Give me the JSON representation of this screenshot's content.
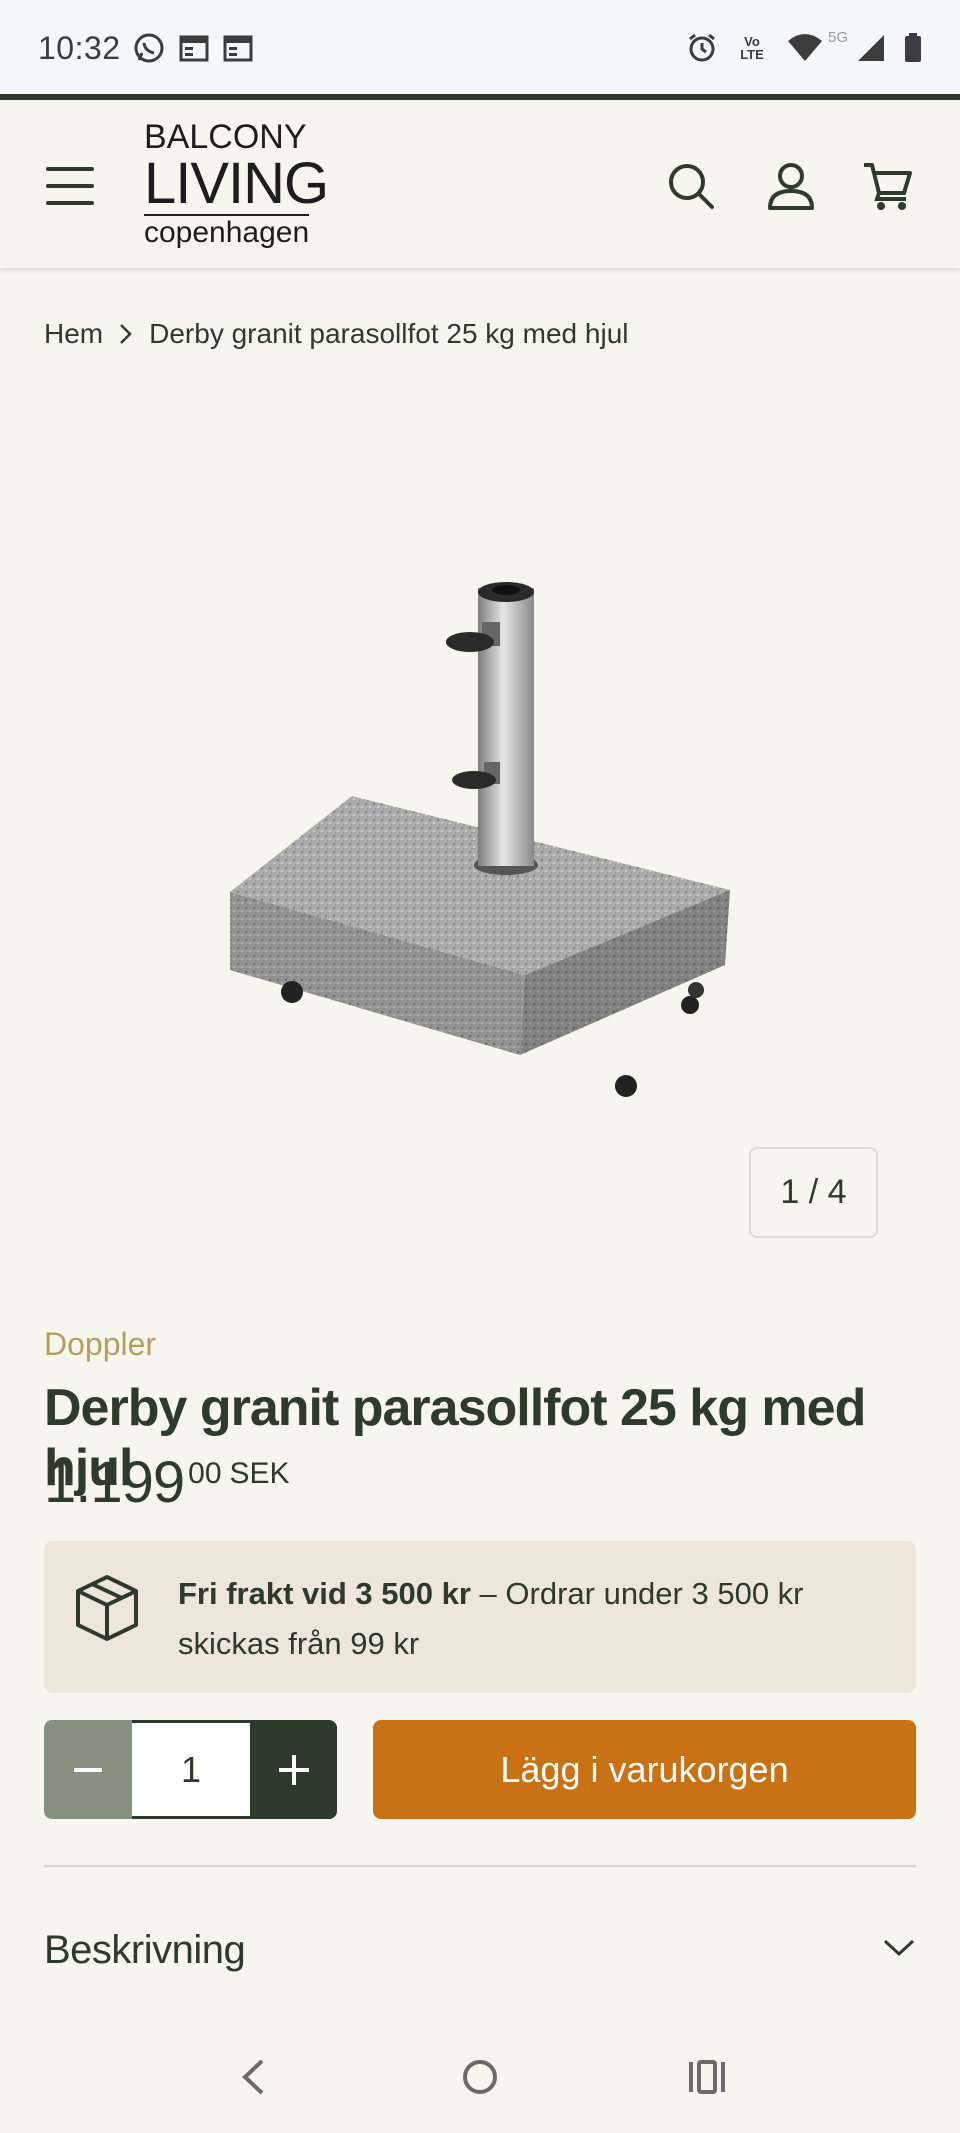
{
  "status_bar": {
    "time": "10:32",
    "network": "5G",
    "volte": "Vo LTE",
    "icons_left": [
      "whatsapp-icon",
      "calendar-icon",
      "calendar-icon"
    ],
    "icons_right": [
      "alarm-icon",
      "volte-icon",
      "wifi-icon",
      "signal-icon",
      "battery-icon"
    ]
  },
  "header": {
    "logo": {
      "line1": "BALCONY",
      "line2": "LIVING",
      "line3": "copenhagen"
    },
    "icons": [
      "menu-icon",
      "search-icon",
      "account-icon",
      "cart-icon"
    ]
  },
  "breadcrumb": {
    "home": "Hem",
    "current": "Derby granit parasollfot 25 kg med hjul"
  },
  "gallery": {
    "pager": "1 / 4"
  },
  "product": {
    "brand": "Doppler",
    "title": "Derby granit parasollfot 25 kg med hjul",
    "price_main": "1.199",
    "price_cents": "00",
    "currency": "SEK"
  },
  "shipping": {
    "bold": "Fri frakt vid 3 500 kr",
    "rest": " – Ordrar under 3 500 kr skickas från 99 kr"
  },
  "quantity": {
    "value": "1"
  },
  "add_to_cart": {
    "label": "Lägg i varukorgen"
  },
  "accordion": {
    "label": "Beskrivning"
  },
  "colors": {
    "accent": "#c87115",
    "dark_green": "#2e3a2a",
    "muted_green": "#86907f",
    "brand_gold": "#b59f60",
    "background": "#f7f6ee"
  }
}
